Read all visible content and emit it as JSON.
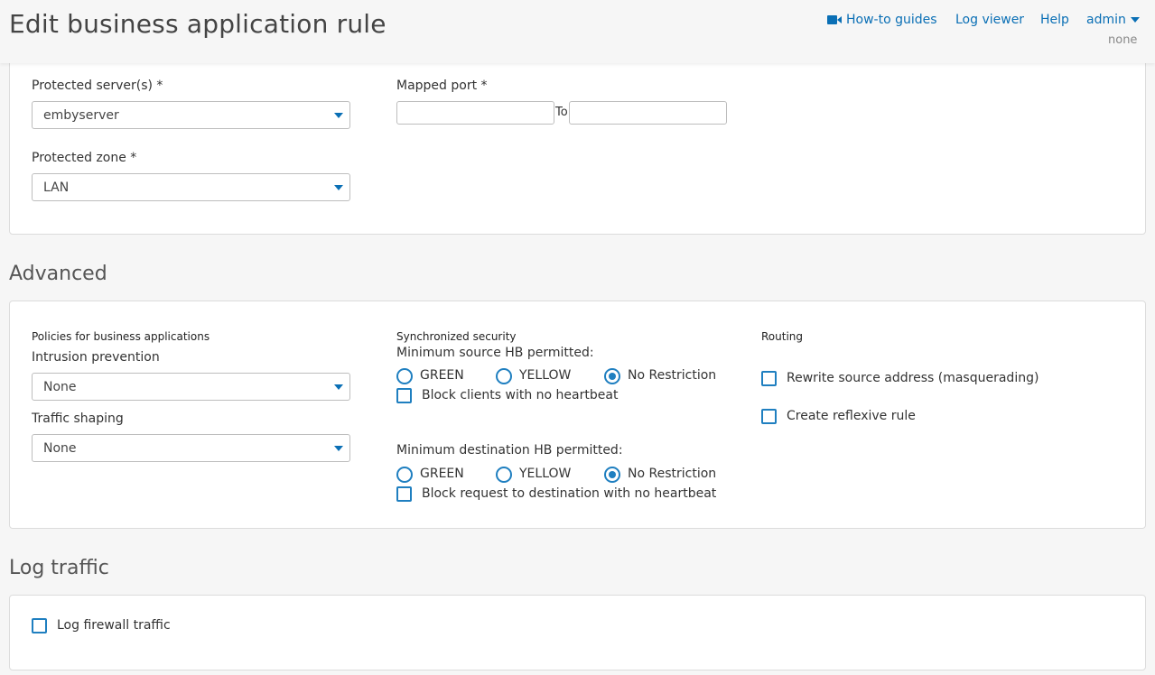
{
  "header": {
    "title": "Edit business application rule",
    "links": {
      "howto": "How-to guides",
      "log_viewer": "Log viewer",
      "help": "Help",
      "user": "admin",
      "user_sub": "none"
    }
  },
  "server_panel": {
    "protected_servers_label": "Protected server(s) *",
    "protected_servers_value": "embyserver",
    "mapped_port_label": "Mapped port *",
    "mapped_port_from": "",
    "mapped_port_to_sep": "To",
    "mapped_port_to": "",
    "protected_zone_label": "Protected zone *",
    "protected_zone_value": "LAN"
  },
  "advanced": {
    "section_title": "Advanced",
    "policies_heading": "Policies for business applications",
    "intrusion_label": "Intrusion prevention",
    "intrusion_value": "None",
    "traffic_label": "Traffic shaping",
    "traffic_value": "None",
    "sync_heading": "Synchronized security",
    "min_source_label": "Minimum source HB permitted:",
    "min_dest_label": "Minimum destination HB permitted:",
    "radio_options": [
      "GREEN",
      "YELLOW",
      "No Restriction"
    ],
    "source_selected": "No Restriction",
    "dest_selected": "No Restriction",
    "block_clients_label": "Block clients with no heartbeat",
    "block_request_label": "Block request to destination with no heartbeat",
    "routing_heading": "Routing",
    "rewrite_label": "Rewrite source address (masquerading)",
    "reflexive_label": "Create reflexive rule"
  },
  "log": {
    "section_title": "Log traffic",
    "log_firewall_label": "Log firewall traffic"
  },
  "colors": {
    "accent": "#1f7fc0",
    "link": "#0a6fb5"
  }
}
